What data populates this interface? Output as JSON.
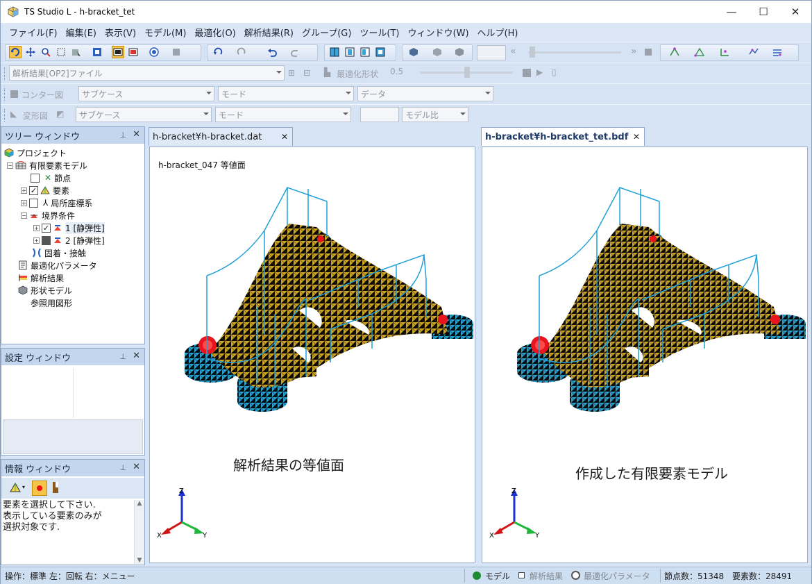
{
  "window": {
    "title": "TS Studio L - h-bracket_tet",
    "minimize": "—",
    "maximize": "☐",
    "close": "✕"
  },
  "menu": [
    "ファイル(F)",
    "編集(E)",
    "表示(V)",
    "モデル(M)",
    "最適化(O)",
    "解析結果(R)",
    "グループ(G)",
    "ツール(T)",
    "ウィンドウ(W)",
    "ヘルプ(H)"
  ],
  "toolbar2": {
    "result_file_combo": "解析結果[OP2]ファイル",
    "opt_shape_label": "最適化形状",
    "opt_value": "0.5"
  },
  "toolbar3": {
    "contour_label": "コンター図",
    "subcase": "サブケース",
    "mode": "モード",
    "data": "データ"
  },
  "toolbar4": {
    "deform_label": "変形図",
    "subcase": "サブケース",
    "mode": "モード",
    "model_ratio": "モデル比"
  },
  "tree_window": {
    "title": "ツリー ウィンドウ",
    "pin": "⸿",
    "close": "✕",
    "items": [
      {
        "label": "プロジェクト"
      },
      {
        "label": "有限要素モデル"
      },
      {
        "label": "節点"
      },
      {
        "label": "要素"
      },
      {
        "label": "局所座標系"
      },
      {
        "label": "境界条件"
      },
      {
        "label": "1 [静弾性]"
      },
      {
        "label": "2 [静弾性]"
      },
      {
        "label": "固着・接触"
      },
      {
        "label": "最適化パラメータ"
      },
      {
        "label": "解析結果"
      },
      {
        "label": "形状モデル"
      },
      {
        "label": "参照用図形"
      }
    ]
  },
  "settings_window": {
    "title": "設定 ウィンドウ"
  },
  "info_window": {
    "title": "情報 ウィンドウ",
    "message": [
      "要素を選択して下さい.",
      "表示している要素のみが",
      "選択対象です."
    ]
  },
  "tabs": {
    "left": {
      "label": "h-bracket¥h-bracket.dat",
      "close": "✕"
    },
    "right": {
      "label": "h-bracket¥h-bracket_tet.bdf",
      "close": "✕"
    }
  },
  "left_view": {
    "title": "h-bracket_047 等値面",
    "caption": "解析結果の等値面",
    "axes": {
      "z": "Z",
      "x": "X",
      "y": "Y"
    }
  },
  "right_view": {
    "caption": "作成した有限要素モデル",
    "axes": {
      "z": "Z",
      "x": "X",
      "y": "Y"
    }
  },
  "status": {
    "operation": "操作：標準 左：回転 右：メニュー",
    "model": "モデル",
    "result": "解析結果",
    "opt_param": "最適化パラメータ",
    "nodes": "節点数：51348",
    "elements": "要素数：28491"
  },
  "colors": {
    "mesh": "#c9a227",
    "mesh_line": "#4a3a10",
    "boss": "#2aa1cf",
    "load": "#e8141e",
    "frame": "#1fa0d6"
  }
}
